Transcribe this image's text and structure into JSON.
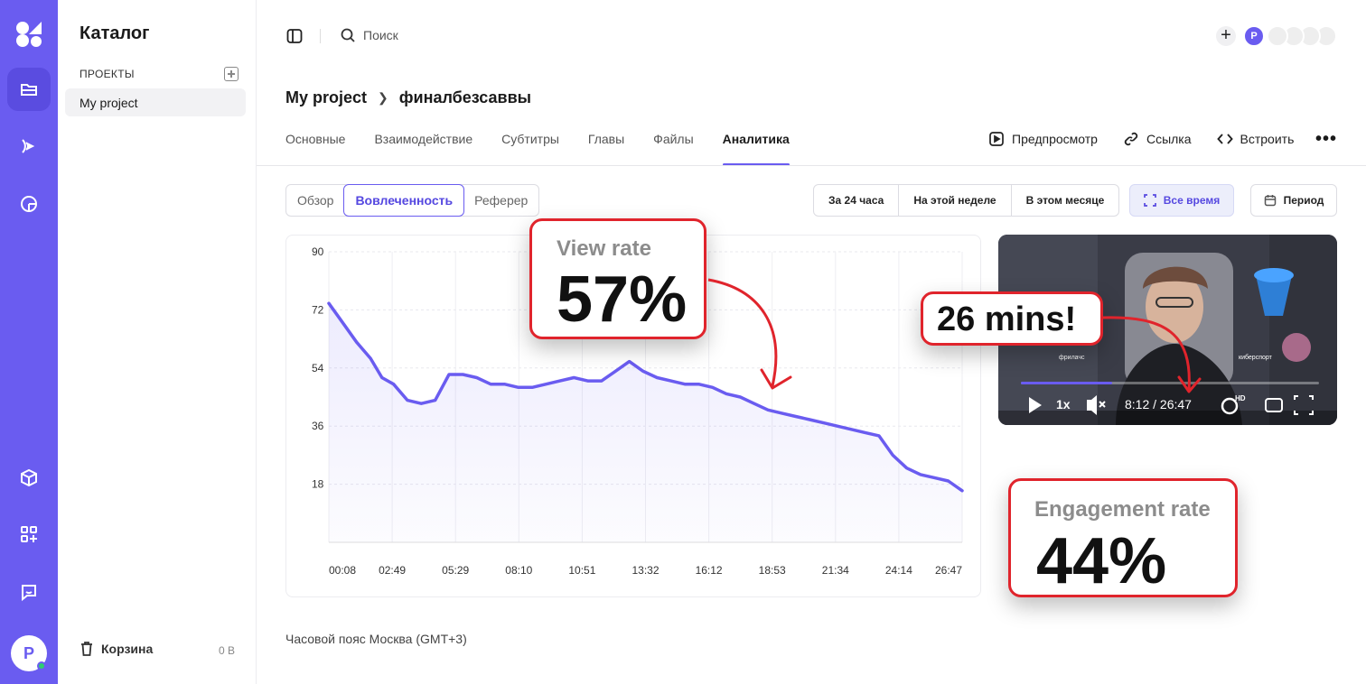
{
  "sidebar": {
    "title": "Каталог",
    "section": "ПРОЕКТЫ",
    "project": "My project",
    "trash_label": "Корзина",
    "trash_size": "0 B"
  },
  "topbar": {
    "search_label": "Поиск",
    "user_initial": "P"
  },
  "breadcrumb": {
    "project": "My project",
    "page": "финалбезсаввы"
  },
  "tabs": [
    "Основные",
    "Взаимодействие",
    "Субтитры",
    "Главы",
    "Файлы",
    "Аналитика"
  ],
  "active_tab": "Аналитика",
  "actions": {
    "preview": "Предпросмотр",
    "link": "Ссылка",
    "embed": "Встроить"
  },
  "segments": [
    "Обзор",
    "Вовлеченность",
    "Реферер"
  ],
  "selected_segment": "Вовлеченность",
  "ranges": [
    "За 24 часа",
    "На этой неделе",
    "В этом месяце"
  ],
  "all_time": "Все время",
  "period": "Период",
  "timezone": "Часовой пояс Москва (GMT+3)",
  "colors": {
    "accent": "#6a5cf0",
    "callout_border": "#e0242c"
  },
  "chart_data": {
    "type": "area",
    "y_ticks": [
      90,
      72,
      54,
      36,
      18
    ],
    "ylim": [
      0,
      90
    ],
    "x_ticks": [
      "00:08",
      "02:49",
      "05:29",
      "08:10",
      "10:51",
      "13:32",
      "16:12",
      "18:53",
      "21:34",
      "24:14",
      "26:47"
    ],
    "grid": true,
    "series": [
      {
        "x": [
          0.0,
          0.6,
          1.2,
          1.8,
          2.3,
          2.8,
          3.4,
          4.0,
          4.6,
          5.2,
          5.8,
          6.4,
          7.0,
          7.6,
          8.2,
          8.8,
          9.4,
          10.0,
          10.6,
          11.2,
          11.8,
          12.4,
          13.0,
          13.6,
          14.2,
          14.8,
          15.4,
          16.0,
          16.6,
          17.2,
          17.8,
          18.4,
          19.0,
          19.6,
          20.2,
          20.8,
          21.4,
          22.0,
          22.6,
          23.2,
          23.8,
          24.4,
          25.0,
          25.6,
          26.2,
          26.8,
          27.4
        ],
        "values": [
          74,
          68,
          62,
          57,
          51,
          49,
          44,
          43,
          44,
          52,
          52,
          51,
          49,
          49,
          48,
          48,
          49,
          50,
          51,
          50,
          50,
          53,
          56,
          53,
          51,
          50,
          49,
          49,
          48,
          46,
          45,
          43,
          41,
          40,
          39,
          38,
          37,
          36,
          35,
          34,
          33,
          27,
          23,
          21,
          20,
          19,
          16
        ]
      }
    ]
  },
  "video": {
    "speed": "1x",
    "time": "8:12 / 26:47",
    "progress": 0.306,
    "label_left": "фрилачс",
    "label_right": "киберспорт"
  },
  "callouts": {
    "view_rate_label": "View rate",
    "view_rate_value": "57%",
    "mins": "26 mins!",
    "engagement_label": "Engagement rate",
    "engagement_value": "44%"
  }
}
